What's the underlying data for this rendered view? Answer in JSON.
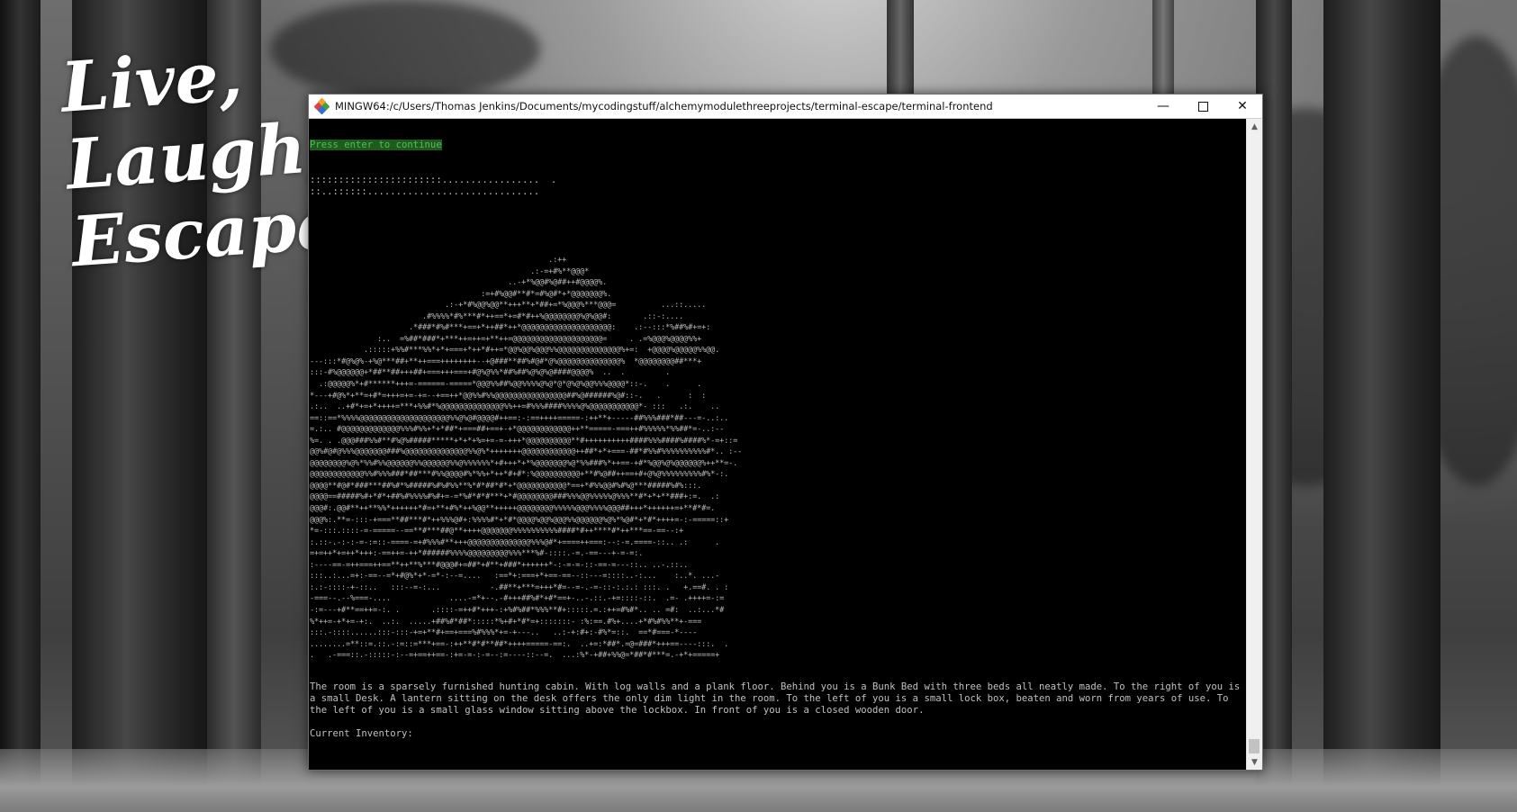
{
  "wallpaper": {
    "tagline_lines": [
      "Live,",
      "Laugh,",
      "Escape"
    ]
  },
  "window": {
    "title": "MINGW64:/c/Users/Thomas Jenkins/Documents/mycodingstuff/alchemymodulethreeprojects/terminal-escape/terminal-frontend",
    "minimize_icon": "minimize-icon",
    "maximize_icon": "maximize-icon",
    "close_icon": "close-icon"
  },
  "terminal": {
    "prompt_hint": "Press enter to continue",
    "progress_lines": [
      ":::::::::::::::::::::::.................  .",
      "::..::::::.............................."
    ],
    "ascii_art": [
      "                                                     .:++",
      "                                                 .:-=+#%**@@@*",
      "                                            ..-+*%@@#%@##++#@@@@%.",
      "                                      :=+#%@@#**#*=#%@#*+*@@@@@@@%.",
      "                              .:-+*#%@@%@@**+++**+*##+=*%@@@%***@@@=          ...::.....",
      "                         .#%%%%*#%***#*++==*+=#*#++%@@@@@@@@%@%@@#:       .::-:....",
      "                      .*###*#%#***+==+*++##*++*@@@@@@@@@@@@@@@@@@@@:    .:--:::*%##%#+=+:",
      "               :..  =%##*###*+***++=++=+**++=@@@@@@@@@@@@@@@@@@@@=     . .=%@@@%@@@@%%+",
      "            .:::::+%%#***%%*+*+===+*++*#++=*@@%@@%@@@%%@@@@@@@@@@@@@@%+=:  +@@@@%@@@@@%%@@.",
      "---:::*#@%@%-+%@***##+**++===++++++++--+@###**##%#@#*@%@@@@@@@@@@@@@@%  *@@@@@@@@##***+",
      ":::-#%@@@@@@+*##**##+++##+===+++===+#@%@%%*##%##%@%@%@####@@@@%  ..  .         .",
      "  .:@@@@@%*+#******+++=-======-=====*@@@%%##%@@%%%%@%@*@*@%@%@@%%%@@@@*::-.    .      .",
      "*---+#@%*+**=+#*=+++=+=-+=--+==++*@@%%#%%@@@@@@@@@@@@@@@@##%@######%@#::-.   .      :  :",
      ".:..  ..+#*+=+*++++=***+%%#*%@@@@@@@@@@@@@@%%++=#%%%####%%%%@%@@@@@@@@@@@*- :::   .:.    ..",
      "==::==*%%%%@@@@@@@@@@@@@@@@@@@@%%@%@#@@@@#++==:-:==++++=====-:++**+-----##%%%###*##---=-..:..",
      "=.:.. #@@@@@@@@@@@@@%%%#%%+*+*##*+===##+==+-+*@@@@@@@@@@@@++**=====-===++#%%%%%*%%##*=-..:--",
      "%=. . .@@@###%%#**#%@%#####*****+*+*+%=+=-=-+++*@@@@@@@@@@**#++++++++++####%%%####%####%*-=+::=",
      "@@%#@#@%%%@@@@@@@###%@@@@@@@@@@@@@@%%@%*+++++++@@@@@@@@@@@@++##*+*+===-##*#%%#%%%%%%%%%%#*.. :--",
      "@@@@@@@@%@%*%%#%%@@@@@@%%@@@@@@%%@%%%%%%*+#+++*+*%@@@@@@@%@*%%###%*++==-+#*%@@%@%@@@@@@%++**=-.",
      "@@@@@@@@@@@@%%#%%%###*##***#%%@@@@#%*%%+*++*#+#*:%@@@@@@@@@@+**#%@##++==+#+@%@%%%%%%%%%#%*-:.",
      "@@@@**#@#*###***##%#*%#####%#%#%%**%*#*##*#*+*@@@@@@@@@@@*==+*#%%@@#%#%@***#####%#%:::.",
      "@@@@==#####%#+*#*+##%#%%%%#%#+=-=*%#*#*#***+*#@@@@@@@@###%%%@@%%%%%@%%%**#*+*+**###+:=.  .:",
      "@@@#:.@@#**++**%%*++++++*#=+**+#%*++%@@**+++++@@@@@@@@%%%%%@@@%%%%@@@##+++*++++++=+**#*#=.",
      "@@@%:.**=-:::-+===**##***#*++%%%@#+:%%%%#*+*#*@@@@%@@%@@@%%@@@@@@%@%*%@#*+*#*++++=-:-=====::+",
      "*=-:::.::::-=-=====--==**#***##@**++++@@@@@@@%%%%%%%%%%####*#++****#*++***==-==--:+",
      ":.::-.-:-:-=-:=::-====-=+#%%%#**+++@@@@@@@@@@@@@@%%%@#*+====++===:--:-=.====-::.. .:      .",
      "=+=++*+=++*+++:-==++=-++*######%%%%@@@@@@@@@%%%***%#-::::.-=.-==---+-=-=:.",
      ":----==-=++===++==**++**%***#@@@#+=##*+#**+###*++++++*-:-=-=-::-==-=---::.. ..-.::..",
      ":::..:...=+:-==--=*+#@%*+*-=*-:--=....   :==*+:===+*+==-==--::---=::::..-:...    :..*. ...-",
      ":.:-::::-+-::..   :::--=-:...           -.##**+***=+++*#=--=-.-=-::-:.:.: :::. .   +.==#. . :",
      "-===--.--%===-....             ....-=*+--.-#+++##%#*+#*==+-..-.::.-+=::::-::.  .=- .++++=-:=",
      "-:=---+#**==++=-:. .       .::::-=++#*+++-:+%#%##*%%%**#+:::::.=.:++=#%#*.. .. =#:  ..:...*#",
      "%*++=-+*+=-+:.  ..:.  .....+##%#*##*:::::*%+#+*#*=+:::::::- :%:==.#%+....+*#%#%%**+-===",
      ":::.-::::......:::-:::-+=+**#+==+===%#%%%*+=-+---..   ..:-+:#+:-#%*=::.  ==*#===-*----",
      "........=**::=.::.-:=::=***+==-:++**#*#**##*++++=====-==:.  ..+=:*##*.=@=###*+++==----:::.  .",
      ".   .-===::.-:::::-:--=+==++==-:+=-=-:-=--:=----::--=.  ...:%*-+##+%%@=*##*#***=.-+*+=====+"
    ],
    "description": "The room is a sparsely furnished hunting cabin. With log walls and a plank floor. Behind you is a Bunk Bed with three beds all neatly made. To the right of you is a small Desk. A lantern sitting on the desk offers the only dim light in the room. To the left of you is a small lock box, beaten and worn from years of use. To the left of you is a small glass window sitting above the lockbox. In front of you is a closed wooden door.",
    "inventory_label": "Current Inventory:"
  },
  "scrollbar": {
    "up_icon": "scroll-up-arrow-icon",
    "down_icon": "scroll-down-arrow-icon",
    "position": 1.0
  }
}
